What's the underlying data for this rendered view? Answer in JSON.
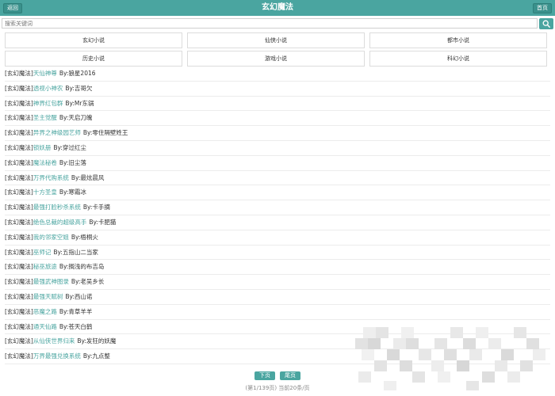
{
  "header": {
    "back_label": "返回",
    "title": "玄幻魔法",
    "home_label": "首页"
  },
  "search": {
    "placeholder": "搜索关键词"
  },
  "categories": [
    {
      "label": "玄幻小说"
    },
    {
      "label": "仙侠小说"
    },
    {
      "label": "都市小说"
    },
    {
      "label": "历史小说"
    },
    {
      "label": "游戏小说"
    },
    {
      "label": "科幻小说"
    }
  ],
  "book_list": [
    {
      "tag": "[玄幻魔法]",
      "title": "天仙神尊",
      "author": "By:狼星2016"
    },
    {
      "tag": "[玄幻魔法]",
      "title": "透视小神农",
      "author": "By:吉哥欠"
    },
    {
      "tag": "[玄幻魔法]",
      "title": "神界红包群",
      "author": "By:Mr东锅"
    },
    {
      "tag": "[玄幻魔法]",
      "title": "圣主觉醒",
      "author": "By:天启刀魄"
    },
    {
      "tag": "[玄幻魔法]",
      "title": "异界之神级园艺师",
      "author": "By:零住隔壁姓王"
    },
    {
      "tag": "[玄幻魔法]",
      "title": "锁妖册",
      "author": "By:穿过红尘"
    },
    {
      "tag": "[玄幻魔法]",
      "title": "魔法秘卷",
      "author": "By:旧尘落"
    },
    {
      "tag": "[玄幻魔法]",
      "title": "万界代购系统",
      "author": "By:最炫晨风"
    },
    {
      "tag": "[玄幻魔法]",
      "title": "十方圣皇",
      "author": "By:寒霜冰"
    },
    {
      "tag": "[玄幻魔法]",
      "title": "最强打脸秒杀系统",
      "author": "By:卡手摘"
    },
    {
      "tag": "[玄幻魔法]",
      "title": "绝色总裁的超级高手",
      "author": "By:卡肥猫"
    },
    {
      "tag": "[玄幻魔法]",
      "title": "我的邻家空姐",
      "author": "By:梧桐火"
    },
    {
      "tag": "[玄幻魔法]",
      "title": "巫师记",
      "author": "By:五指山二当家"
    },
    {
      "tag": "[玄幻魔法]",
      "title": "秘巫旅途",
      "author": "By:搁浅的布吉岛"
    },
    {
      "tag": "[玄幻魔法]",
      "title": "最强武神图录",
      "author": "By:老吴乡长"
    },
    {
      "tag": "[玄幻魔法]",
      "title": "最强天赋树",
      "author": "By:西山诺"
    },
    {
      "tag": "[玄幻魔法]",
      "title": "恶魔之路",
      "author": "By:青草羊羊"
    },
    {
      "tag": "[玄幻魔法]",
      "title": "通天仙路",
      "author": "By:苍天白鹤"
    },
    {
      "tag": "[玄幻魔法]",
      "title": "从仙侠世界归来",
      "author": "By:发狂的妖魔"
    },
    {
      "tag": "[玄幻魔法]",
      "title": "万界最强兑换系统",
      "author": "By:九点整"
    }
  ],
  "pager": {
    "next_label": "下页",
    "last_label": "尾页",
    "info": "(第1/139页) 当前20条/页"
  },
  "colors": {
    "accent": "#4aa5a0"
  }
}
